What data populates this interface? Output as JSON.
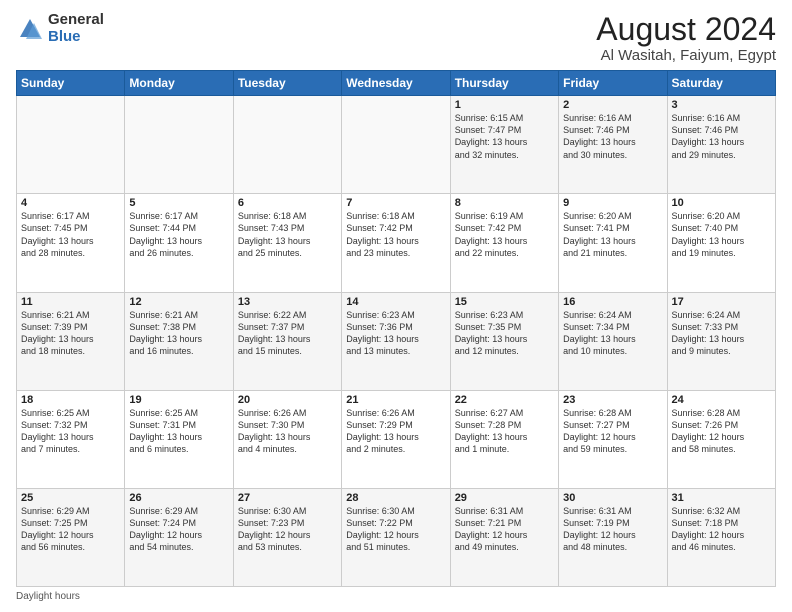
{
  "logo": {
    "general": "General",
    "blue": "Blue"
  },
  "title": "August 2024",
  "subtitle": "Al Wasitah, Faiyum, Egypt",
  "days_of_week": [
    "Sunday",
    "Monday",
    "Tuesday",
    "Wednesday",
    "Thursday",
    "Friday",
    "Saturday"
  ],
  "footer_label": "Daylight hours",
  "weeks": [
    [
      {
        "day": "",
        "info": ""
      },
      {
        "day": "",
        "info": ""
      },
      {
        "day": "",
        "info": ""
      },
      {
        "day": "",
        "info": ""
      },
      {
        "day": "1",
        "info": "Sunrise: 6:15 AM\nSunset: 7:47 PM\nDaylight: 13 hours\nand 32 minutes."
      },
      {
        "day": "2",
        "info": "Sunrise: 6:16 AM\nSunset: 7:46 PM\nDaylight: 13 hours\nand 30 minutes."
      },
      {
        "day": "3",
        "info": "Sunrise: 6:16 AM\nSunset: 7:46 PM\nDaylight: 13 hours\nand 29 minutes."
      }
    ],
    [
      {
        "day": "4",
        "info": "Sunrise: 6:17 AM\nSunset: 7:45 PM\nDaylight: 13 hours\nand 28 minutes."
      },
      {
        "day": "5",
        "info": "Sunrise: 6:17 AM\nSunset: 7:44 PM\nDaylight: 13 hours\nand 26 minutes."
      },
      {
        "day": "6",
        "info": "Sunrise: 6:18 AM\nSunset: 7:43 PM\nDaylight: 13 hours\nand 25 minutes."
      },
      {
        "day": "7",
        "info": "Sunrise: 6:18 AM\nSunset: 7:42 PM\nDaylight: 13 hours\nand 23 minutes."
      },
      {
        "day": "8",
        "info": "Sunrise: 6:19 AM\nSunset: 7:42 PM\nDaylight: 13 hours\nand 22 minutes."
      },
      {
        "day": "9",
        "info": "Sunrise: 6:20 AM\nSunset: 7:41 PM\nDaylight: 13 hours\nand 21 minutes."
      },
      {
        "day": "10",
        "info": "Sunrise: 6:20 AM\nSunset: 7:40 PM\nDaylight: 13 hours\nand 19 minutes."
      }
    ],
    [
      {
        "day": "11",
        "info": "Sunrise: 6:21 AM\nSunset: 7:39 PM\nDaylight: 13 hours\nand 18 minutes."
      },
      {
        "day": "12",
        "info": "Sunrise: 6:21 AM\nSunset: 7:38 PM\nDaylight: 13 hours\nand 16 minutes."
      },
      {
        "day": "13",
        "info": "Sunrise: 6:22 AM\nSunset: 7:37 PM\nDaylight: 13 hours\nand 15 minutes."
      },
      {
        "day": "14",
        "info": "Sunrise: 6:23 AM\nSunset: 7:36 PM\nDaylight: 13 hours\nand 13 minutes."
      },
      {
        "day": "15",
        "info": "Sunrise: 6:23 AM\nSunset: 7:35 PM\nDaylight: 13 hours\nand 12 minutes."
      },
      {
        "day": "16",
        "info": "Sunrise: 6:24 AM\nSunset: 7:34 PM\nDaylight: 13 hours\nand 10 minutes."
      },
      {
        "day": "17",
        "info": "Sunrise: 6:24 AM\nSunset: 7:33 PM\nDaylight: 13 hours\nand 9 minutes."
      }
    ],
    [
      {
        "day": "18",
        "info": "Sunrise: 6:25 AM\nSunset: 7:32 PM\nDaylight: 13 hours\nand 7 minutes."
      },
      {
        "day": "19",
        "info": "Sunrise: 6:25 AM\nSunset: 7:31 PM\nDaylight: 13 hours\nand 6 minutes."
      },
      {
        "day": "20",
        "info": "Sunrise: 6:26 AM\nSunset: 7:30 PM\nDaylight: 13 hours\nand 4 minutes."
      },
      {
        "day": "21",
        "info": "Sunrise: 6:26 AM\nSunset: 7:29 PM\nDaylight: 13 hours\nand 2 minutes."
      },
      {
        "day": "22",
        "info": "Sunrise: 6:27 AM\nSunset: 7:28 PM\nDaylight: 13 hours\nand 1 minute."
      },
      {
        "day": "23",
        "info": "Sunrise: 6:28 AM\nSunset: 7:27 PM\nDaylight: 12 hours\nand 59 minutes."
      },
      {
        "day": "24",
        "info": "Sunrise: 6:28 AM\nSunset: 7:26 PM\nDaylight: 12 hours\nand 58 minutes."
      }
    ],
    [
      {
        "day": "25",
        "info": "Sunrise: 6:29 AM\nSunset: 7:25 PM\nDaylight: 12 hours\nand 56 minutes."
      },
      {
        "day": "26",
        "info": "Sunrise: 6:29 AM\nSunset: 7:24 PM\nDaylight: 12 hours\nand 54 minutes."
      },
      {
        "day": "27",
        "info": "Sunrise: 6:30 AM\nSunset: 7:23 PM\nDaylight: 12 hours\nand 53 minutes."
      },
      {
        "day": "28",
        "info": "Sunrise: 6:30 AM\nSunset: 7:22 PM\nDaylight: 12 hours\nand 51 minutes."
      },
      {
        "day": "29",
        "info": "Sunrise: 6:31 AM\nSunset: 7:21 PM\nDaylight: 12 hours\nand 49 minutes."
      },
      {
        "day": "30",
        "info": "Sunrise: 6:31 AM\nSunset: 7:19 PM\nDaylight: 12 hours\nand 48 minutes."
      },
      {
        "day": "31",
        "info": "Sunrise: 6:32 AM\nSunset: 7:18 PM\nDaylight: 12 hours\nand 46 minutes."
      }
    ]
  ]
}
